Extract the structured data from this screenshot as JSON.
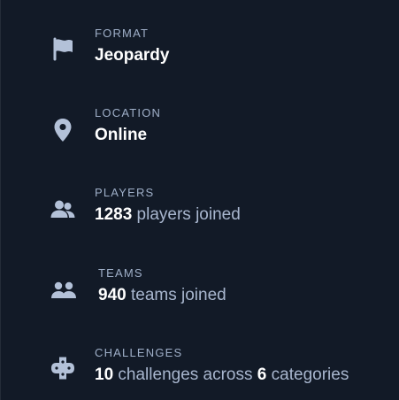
{
  "format": {
    "icon": "flag-icon",
    "label": "FORMAT",
    "value": "Jeopardy"
  },
  "location": {
    "icon": "map-pin-icon",
    "label": "LOCATION",
    "value": "Online"
  },
  "players": {
    "icon": "users-icon",
    "label": "PLAYERS",
    "count": "1283",
    "suffix": " players joined"
  },
  "teams": {
    "icon": "group-icon",
    "label": "TEAMS",
    "count": "940",
    "suffix": " teams joined"
  },
  "challenges": {
    "icon": "gamepad-icon",
    "label": "CHALLENGES",
    "count": "10",
    "middle": " challenges across ",
    "categories_count": "6",
    "suffix": " categories"
  },
  "colors": {
    "background": "#121a27",
    "label": "#9fafc8",
    "icon": "#b3c1d8",
    "value_strong": "#ffffff",
    "value_muted": "#a8b6ce"
  }
}
